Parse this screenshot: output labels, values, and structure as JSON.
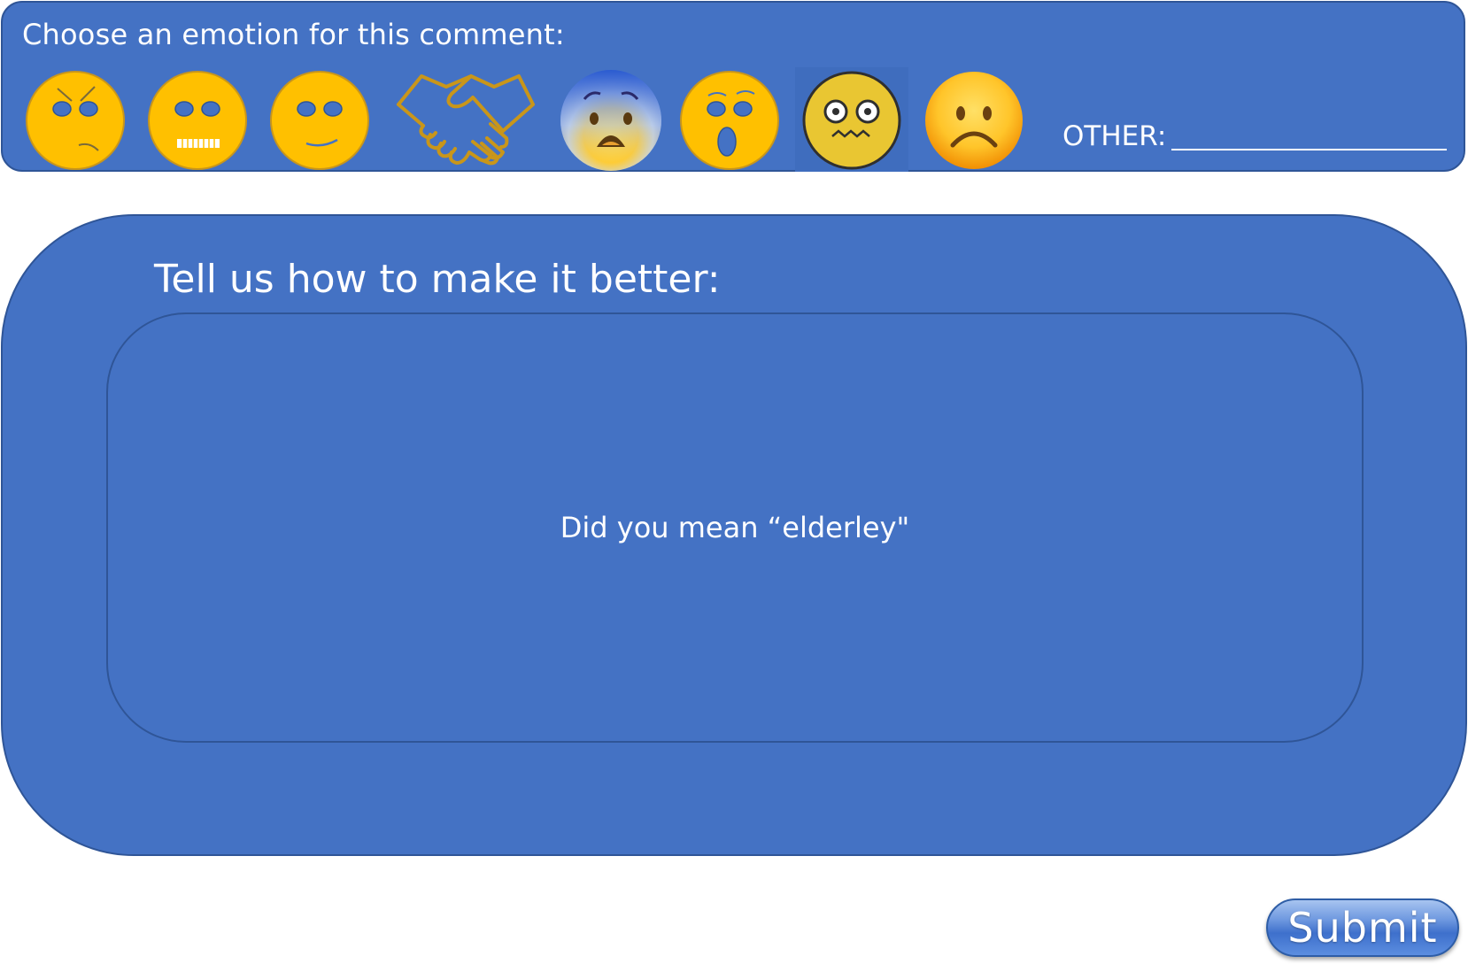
{
  "emotion_bar": {
    "prompt": "Choose an emotion for this comment:",
    "emotions": [
      {
        "icon": "angry-face-icon"
      },
      {
        "icon": "grimacing-face-icon"
      },
      {
        "icon": "slight-smile-face-icon"
      },
      {
        "icon": "handshake-icon"
      },
      {
        "icon": "fearful-face-icon"
      },
      {
        "icon": "surprised-face-icon"
      },
      {
        "icon": "confounded-face-icon"
      },
      {
        "icon": "frowning-face-icon"
      }
    ],
    "other_label": "OTHER:",
    "other_value": ""
  },
  "feedback": {
    "title": "Tell us how to make it better:",
    "body_text": "Did you mean “elderley\""
  },
  "submit": {
    "label": "Submit"
  },
  "colors": {
    "panel": "#4472C4",
    "panel_border": "#2F5597",
    "emoji_flat": "#FFC000",
    "emoji_outline": "#C9961A"
  }
}
